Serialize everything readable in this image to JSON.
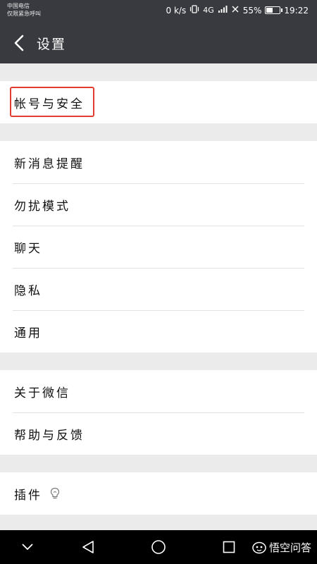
{
  "status_bar": {
    "carrier_line1": "中国电信",
    "carrier_line2": "仅限紧急呼叫",
    "speed": "0 k/s",
    "network": "4G",
    "battery": "55%",
    "battery_level": 0.55,
    "time": "19:22"
  },
  "header": {
    "title": "设置"
  },
  "groups": {
    "account": {
      "label": "帐号与安全"
    },
    "general": {
      "items": [
        "新消息提醒",
        "勿扰模式",
        "聊天",
        "隐私",
        "通用"
      ]
    },
    "about": {
      "items": [
        "关于微信",
        "帮助与反馈"
      ]
    },
    "plugins": {
      "label": "插件"
    }
  },
  "nav_bar": {
    "watermark": "悟空问答"
  },
  "colors": {
    "header_bg": "#393a3f",
    "page_bg": "#ebebeb",
    "highlight": "#e03c31"
  }
}
